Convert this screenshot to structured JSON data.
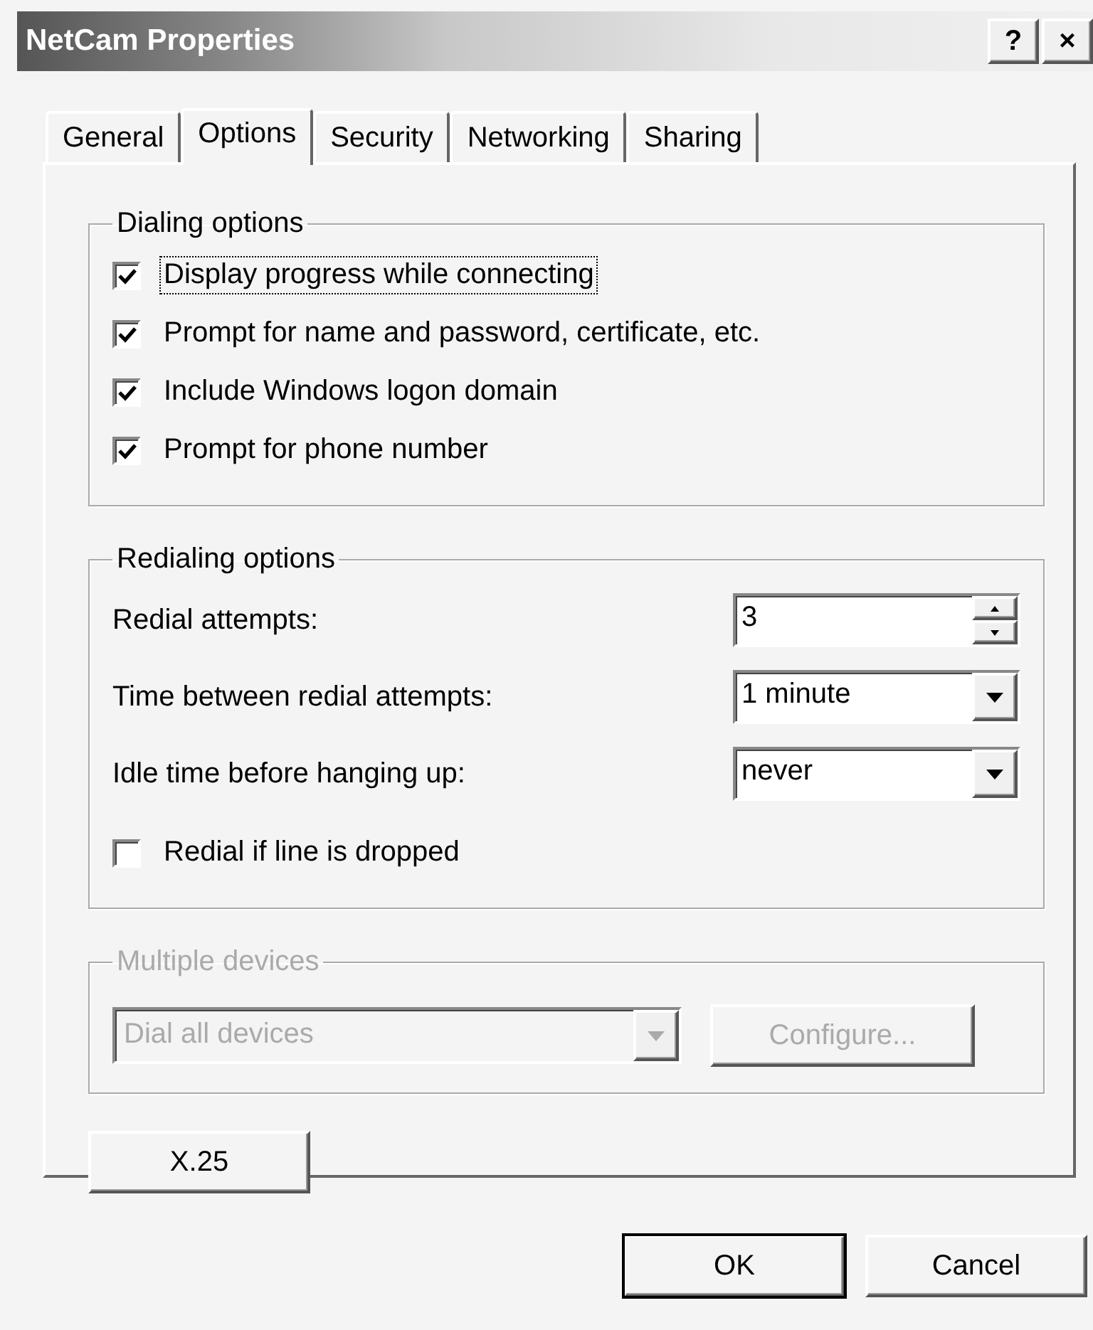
{
  "window": {
    "title": "NetCam Properties",
    "title_buttons": [
      "?",
      "×"
    ]
  },
  "tabs": [
    {
      "label": "General",
      "selected": false
    },
    {
      "label": "Options",
      "selected": true
    },
    {
      "label": "Security",
      "selected": false
    },
    {
      "label": "Networking",
      "selected": false
    },
    {
      "label": "Sharing",
      "selected": false
    }
  ],
  "dialing_options": {
    "title": "Dialing options",
    "items": [
      {
        "label": "Display progress while connecting",
        "checked": true,
        "focused": true
      },
      {
        "label": "Prompt for name and password, certificate, etc.",
        "checked": true,
        "focused": false
      },
      {
        "label": "Include Windows logon domain",
        "checked": true,
        "focused": false
      },
      {
        "label": "Prompt for phone number",
        "checked": true,
        "focused": false
      }
    ]
  },
  "redialing_options": {
    "title": "Redialing options",
    "fields": [
      {
        "kind": "spinner",
        "label": "Redial attempts:",
        "value": "3"
      },
      {
        "kind": "dropdown",
        "label": "Time between redial attempts:",
        "value": "1 minute"
      },
      {
        "kind": "dropdown",
        "label": "Idle time before hanging up:",
        "value": "never"
      }
    ],
    "checkbox": {
      "label": "Redial if line is dropped",
      "checked": false
    }
  },
  "multiple_devices": {
    "title": "Multiple devices",
    "disabled": true,
    "dropdown": "Dial all devices",
    "button": "Configure..."
  },
  "x25_button": "X.25",
  "buttons": [
    {
      "label": "OK",
      "default": true
    },
    {
      "label": "Cancel",
      "default": false
    }
  ]
}
